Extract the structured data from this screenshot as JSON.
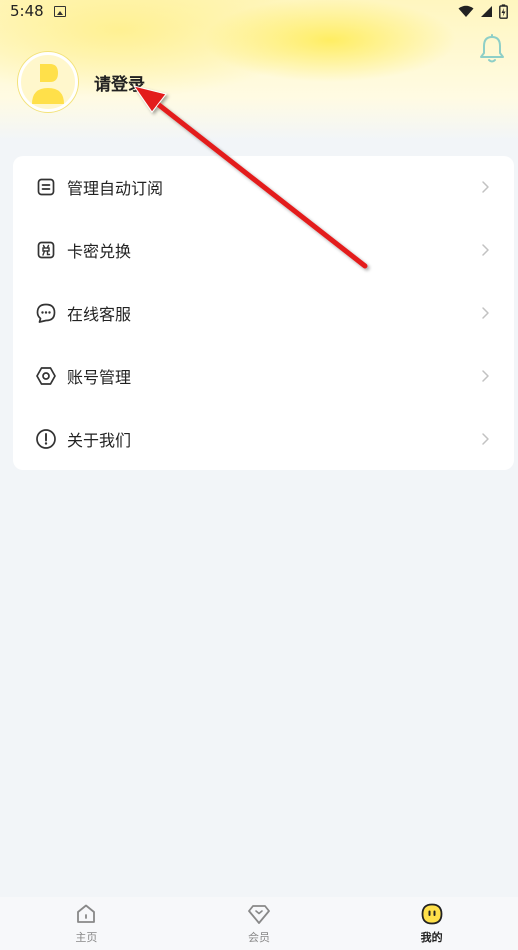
{
  "status_bar": {
    "time": "5:48"
  },
  "profile": {
    "login_text": "请登录"
  },
  "menu": {
    "items": [
      {
        "label": "管理自动订阅",
        "icon": "list-icon"
      },
      {
        "label": "卡密兑换",
        "icon": "redeem-icon"
      },
      {
        "label": "在线客服",
        "icon": "chat-icon"
      },
      {
        "label": "账号管理",
        "icon": "settings-icon"
      },
      {
        "label": "关于我们",
        "icon": "info-icon"
      }
    ]
  },
  "tabbar": {
    "tabs": [
      {
        "label": "主页",
        "icon": "home-icon",
        "active": false
      },
      {
        "label": "会员",
        "icon": "diamond-icon",
        "active": false
      },
      {
        "label": "我的",
        "icon": "profile-icon",
        "active": true
      }
    ]
  },
  "colors": {
    "accent": "#ffe04a",
    "annotation_arrow": "#e31b1b",
    "card": "#ffffff",
    "background": "#f2f5f8"
  }
}
